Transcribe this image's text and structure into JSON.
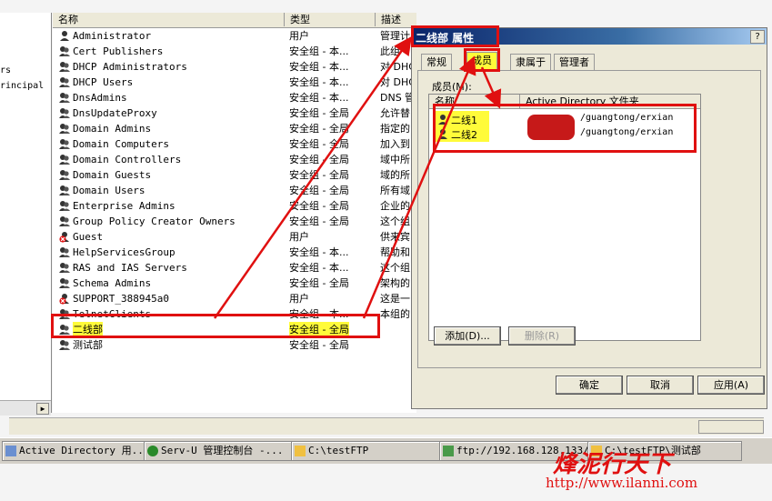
{
  "left_tree": {
    "items": [
      "rs",
      "rincipal"
    ]
  },
  "list": {
    "headers": {
      "name": "名称",
      "type": "类型",
      "desc": "描述"
    },
    "rows": [
      {
        "name": "Administrator",
        "type": "用户",
        "desc": "管理计",
        "icon": "user-icon"
      },
      {
        "name": "Cert Publishers",
        "type": "安全组 - 本...",
        "desc": "此组",
        "icon": "group-icon"
      },
      {
        "name": "DHCP Administrators",
        "type": "安全组 - 本...",
        "desc": "对 DHC",
        "icon": "group-icon"
      },
      {
        "name": "DHCP Users",
        "type": "安全组 - 本...",
        "desc": "对 DHC",
        "icon": "group-icon"
      },
      {
        "name": "DnsAdmins",
        "type": "安全组 - 本...",
        "desc": "DNS 管",
        "icon": "group-icon"
      },
      {
        "name": "DnsUpdateProxy",
        "type": "安全组 - 全局",
        "desc": "允许替",
        "icon": "group-icon"
      },
      {
        "name": "Domain Admins",
        "type": "安全组 - 全局",
        "desc": "指定的",
        "icon": "group-icon"
      },
      {
        "name": "Domain Computers",
        "type": "安全组 - 全局",
        "desc": "加入到",
        "icon": "group-icon"
      },
      {
        "name": "Domain Controllers",
        "type": "安全组 - 全局",
        "desc": "域中所",
        "icon": "group-icon"
      },
      {
        "name": "Domain Guests",
        "type": "安全组 - 全局",
        "desc": "域的所",
        "icon": "group-icon"
      },
      {
        "name": "Domain Users",
        "type": "安全组 - 全局",
        "desc": "所有域",
        "icon": "group-icon"
      },
      {
        "name": "Enterprise Admins",
        "type": "安全组 - 全局",
        "desc": "企业的",
        "icon": "group-icon"
      },
      {
        "name": "Group Policy Creator Owners",
        "type": "安全组 - 全局",
        "desc": "这个组",
        "icon": "group-icon"
      },
      {
        "name": "Guest",
        "type": "用户",
        "desc": "供来宾",
        "icon": "disabled-user-icon"
      },
      {
        "name": "HelpServicesGroup",
        "type": "安全组 - 本...",
        "desc": "帮助和",
        "icon": "group-icon"
      },
      {
        "name": "RAS and IAS Servers",
        "type": "安全组 - 本...",
        "desc": "这个组",
        "icon": "group-icon"
      },
      {
        "name": "Schema Admins",
        "type": "安全组 - 全局",
        "desc": "架构的",
        "icon": "group-icon"
      },
      {
        "name": "SUPPORT_388945a0",
        "type": "用户",
        "desc": "这是一",
        "icon": "disabled-user-icon"
      },
      {
        "name": "TelnetClients",
        "type": "安全组 - 本...",
        "desc": "本组的",
        "icon": "group-icon"
      },
      {
        "name": "二线部",
        "type": "安全组 - 全局",
        "desc": "",
        "icon": "group-icon"
      },
      {
        "name": "测试部",
        "type": "安全组 - 全局",
        "desc": "",
        "icon": "group-icon"
      }
    ]
  },
  "dialog": {
    "title": "二线部 属性",
    "help": "?",
    "tabs": [
      "常规",
      "成员",
      "隶属于",
      "管理者"
    ],
    "active_tab": "成员",
    "members_label": "成员(M):",
    "member_headers": {
      "name": "名称",
      "folder": "Active Directory 文件夹"
    },
    "members": [
      {
        "name": "二线1",
        "folder": "/guangtong/erxian"
      },
      {
        "name": "二线2",
        "folder": "/guangtong/erxian"
      }
    ],
    "add_button": "添加(D)...",
    "remove_button": "删除(R)",
    "ok_button": "确定",
    "cancel_button": "取消",
    "apply_button": "应用(A)"
  },
  "taskbar": {
    "items": [
      "Active Directory 用...",
      "Serv-U 管理控制台 -...",
      "C:\\testFTP",
      "ftp://192.168.128.133/",
      "C:\\testFTP\\测试部"
    ]
  },
  "watermark": {
    "line1": "烽泥行天下",
    "line2": "http://www.ilanni.com"
  },
  "colors": {
    "annotation_red": "#e01010",
    "highlight_yellow": "#fffb3a",
    "title_blue": "#0a246a"
  }
}
